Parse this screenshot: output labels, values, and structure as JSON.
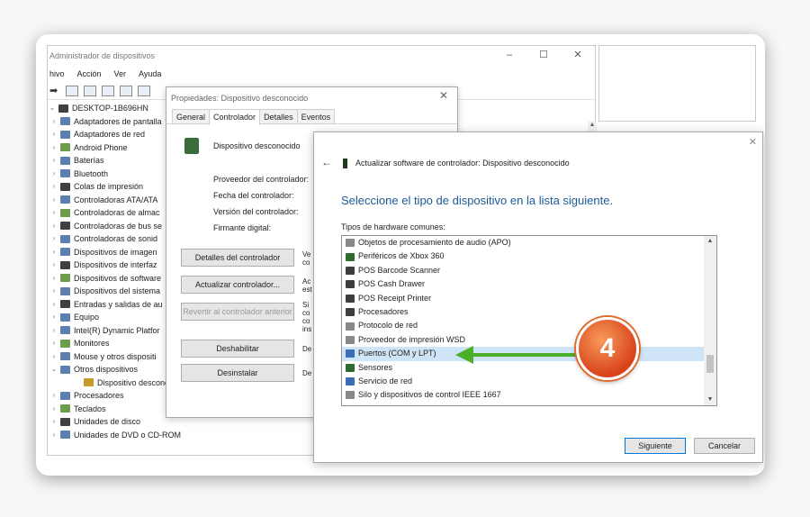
{
  "device_manager": {
    "title": "Administrador de dispositivos",
    "window_controls": [
      "–",
      "☐",
      "✕"
    ],
    "menu": [
      "hivo",
      "Acción",
      "Ver",
      "Ayuda"
    ],
    "tree": [
      {
        "label": "DESKTOP-1B696HN",
        "caret": "⌄",
        "icon": "computer-icon"
      },
      {
        "label": "Adaptadores de pantalla",
        "caret": "›",
        "icon": "display-adapter-icon"
      },
      {
        "label": "Adaptadores de red",
        "caret": "›",
        "icon": "network-adapter-icon"
      },
      {
        "label": "Android Phone",
        "caret": "›",
        "icon": "phone-icon"
      },
      {
        "label": "Baterías",
        "caret": "›",
        "icon": "battery-icon"
      },
      {
        "label": "Bluetooth",
        "caret": "›",
        "icon": "bluetooth-icon"
      },
      {
        "label": "Colas de impresión",
        "caret": "›",
        "icon": "printer-icon"
      },
      {
        "label": "Controladoras ATA/ATA",
        "caret": "›",
        "icon": "ata-controller-icon"
      },
      {
        "label": "Controladoras de almac",
        "caret": "›",
        "icon": "storage-controller-icon"
      },
      {
        "label": "Controladoras de bus se",
        "caret": "›",
        "icon": "usb-icon"
      },
      {
        "label": "Controladoras de sonid",
        "caret": "›",
        "icon": "sound-icon"
      },
      {
        "label": "Dispositivos de imagen",
        "caret": "›",
        "icon": "camera-icon"
      },
      {
        "label": "Dispositivos de interfaz",
        "caret": "›",
        "icon": "hid-icon"
      },
      {
        "label": "Dispositivos de software",
        "caret": "›",
        "icon": "software-device-icon"
      },
      {
        "label": "Dispositivos del sistema",
        "caret": "›",
        "icon": "system-device-icon"
      },
      {
        "label": "Entradas y salidas de au",
        "caret": "›",
        "icon": "audio-io-icon"
      },
      {
        "label": "Equipo",
        "caret": "›",
        "icon": "computer-icon"
      },
      {
        "label": "Intel(R) Dynamic Platfor",
        "caret": "›",
        "icon": "chip-icon"
      },
      {
        "label": "Monitores",
        "caret": "›",
        "icon": "monitor-icon"
      },
      {
        "label": "Mouse y otros dispositi",
        "caret": "›",
        "icon": "mouse-icon"
      },
      {
        "label": "Otros dispositivos",
        "caret": "⌄",
        "icon": "other-devices-icon"
      },
      {
        "label": "Dispositivo descono",
        "caret": "",
        "icon": "unknown-device-icon",
        "indent": true
      },
      {
        "label": "Procesadores",
        "caret": "›",
        "icon": "processor-icon"
      },
      {
        "label": "Teclados",
        "caret": "›",
        "icon": "keyboard-icon"
      },
      {
        "label": "Unidades de disco",
        "caret": "›",
        "icon": "disk-icon"
      },
      {
        "label": "Unidades de DVD o CD-ROM",
        "caret": "›",
        "icon": "dvd-icon"
      }
    ]
  },
  "properties": {
    "title": "Propiedades: Dispositivo desconocido",
    "close": "✕",
    "tabs": [
      "General",
      "Controlador",
      "Detalles",
      "Eventos"
    ],
    "device_name": "Dispositivo desconocido",
    "fields": [
      "Proveedor del controlador:",
      "Fecha del controlador:",
      "Versión del controlador:",
      "Firmante digital:"
    ],
    "buttons": {
      "details": "Detalles del controlador",
      "update": "Actualizar controlador...",
      "rollback": "Revertir al controlador anterior",
      "disable": "Deshabilitar",
      "uninstall": "Desinstalar"
    },
    "desc": {
      "details": "Ve co",
      "update": "Ac est",
      "rollback": "Si co co ins",
      "disable": "De",
      "uninstall": "De"
    }
  },
  "wizard": {
    "close": "✕",
    "back": "←",
    "header": "Actualizar software de controlador: Dispositivo desconocido",
    "title": "Seleccione el tipo de dispositivo en la lista siguiente.",
    "subtitle": "Tipos de hardware comunes:",
    "items": [
      {
        "label": "Objetos de procesamiento de audio (APO)",
        "icon": "audio-apo-icon",
        "color": "gray"
      },
      {
        "label": "Periféricos de Xbox 360",
        "icon": "gamepad-icon",
        "color": "green"
      },
      {
        "label": "POS Barcode Scanner",
        "icon": "barcode-scanner-icon",
        "color": "dark"
      },
      {
        "label": "POS Cash Drawer",
        "icon": "cash-drawer-icon",
        "color": "dark"
      },
      {
        "label": "POS Receipt Printer",
        "icon": "receipt-printer-icon",
        "color": "dark"
      },
      {
        "label": "Procesadores",
        "icon": "processor-icon",
        "color": "dark"
      },
      {
        "label": "Protocolo de red",
        "icon": "network-protocol-icon",
        "color": "gray"
      },
      {
        "label": "Proveedor de impresión WSD",
        "icon": "wsd-print-icon",
        "color": "gray"
      },
      {
        "label": "Puertos (COM y LPT)",
        "icon": "port-icon",
        "color": "blue",
        "selected": true
      },
      {
        "label": "Sensores",
        "icon": "sensor-icon",
        "color": "green"
      },
      {
        "label": "Servicio de red",
        "icon": "network-service-icon",
        "color": "blue"
      },
      {
        "label": "Silo y dispositivos de control IEEE 1667",
        "icon": "ieee1667-icon",
        "color": "gray"
      }
    ],
    "buttons": {
      "next": "Siguiente",
      "cancel": "Cancelar"
    }
  },
  "annotation": {
    "step": "4",
    "accent": "#e05a25",
    "arrow_color": "#4caf2a"
  }
}
